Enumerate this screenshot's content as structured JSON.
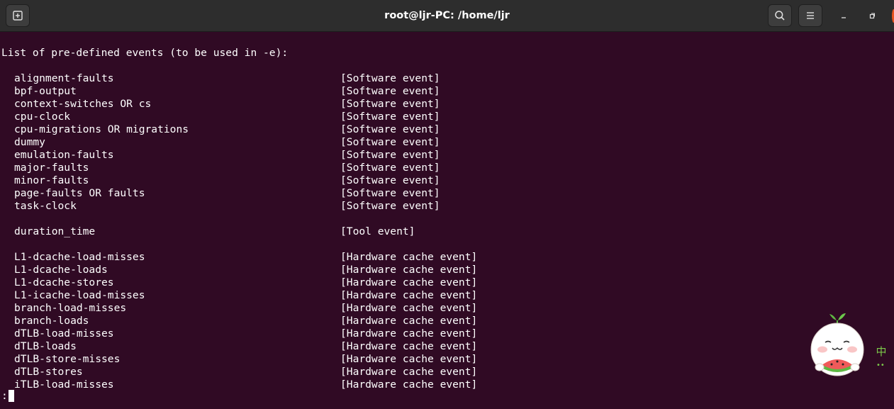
{
  "window": {
    "title": "root@ljr-PC: /home/ljr"
  },
  "terminal": {
    "heading": "List of pre-defined events (to be used in -e):",
    "software_events": [
      {
        "name": "alignment-faults",
        "type": "[Software event]"
      },
      {
        "name": "bpf-output",
        "type": "[Software event]"
      },
      {
        "name": "context-switches OR cs",
        "type": "[Software event]"
      },
      {
        "name": "cpu-clock",
        "type": "[Software event]"
      },
      {
        "name": "cpu-migrations OR migrations",
        "type": "[Software event]"
      },
      {
        "name": "dummy",
        "type": "[Software event]"
      },
      {
        "name": "emulation-faults",
        "type": "[Software event]"
      },
      {
        "name": "major-faults",
        "type": "[Software event]"
      },
      {
        "name": "minor-faults",
        "type": "[Software event]"
      },
      {
        "name": "page-faults OR faults",
        "type": "[Software event]"
      },
      {
        "name": "task-clock",
        "type": "[Software event]"
      }
    ],
    "tool_events": [
      {
        "name": "duration_time",
        "type": "[Tool event]"
      }
    ],
    "cache_events": [
      {
        "name": "L1-dcache-load-misses",
        "type": "[Hardware cache event]"
      },
      {
        "name": "L1-dcache-loads",
        "type": "[Hardware cache event]"
      },
      {
        "name": "L1-dcache-stores",
        "type": "[Hardware cache event]"
      },
      {
        "name": "L1-icache-load-misses",
        "type": "[Hardware cache event]"
      },
      {
        "name": "branch-load-misses",
        "type": "[Hardware cache event]"
      },
      {
        "name": "branch-loads",
        "type": "[Hardware cache event]"
      },
      {
        "name": "dTLB-load-misses",
        "type": "[Hardware cache event]"
      },
      {
        "name": "dTLB-loads",
        "type": "[Hardware cache event]"
      },
      {
        "name": "dTLB-store-misses",
        "type": "[Hardware cache event]"
      },
      {
        "name": "dTLB-stores",
        "type": "[Hardware cache event]"
      },
      {
        "name": "iTLB-load-misses",
        "type": "[Hardware cache event]"
      }
    ],
    "prompt": ":"
  },
  "ime": {
    "mode_label": "中",
    "status": "••"
  },
  "colors": {
    "terminal_bg": "#300a24",
    "titlebar_bg": "#2d2d2d",
    "close_accent": "#e95420",
    "text": "#ffffff"
  },
  "icons": [
    "new-tab-icon",
    "search-icon",
    "hamburger-menu-icon",
    "minimize-icon",
    "maximize-icon",
    "close-icon",
    "watermelon-mascot-icon"
  ]
}
